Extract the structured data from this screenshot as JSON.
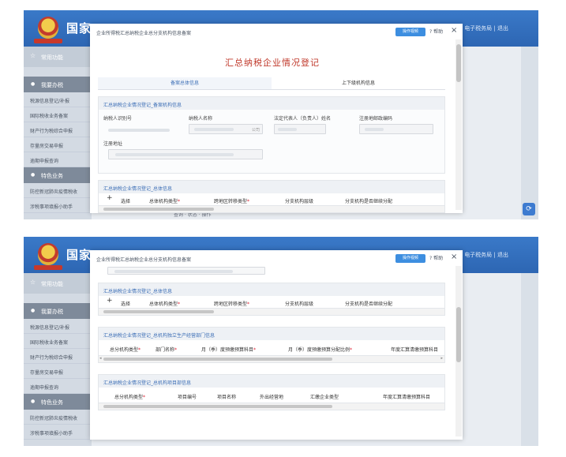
{
  "app": {
    "brand_partial": "国家",
    "header_right": "电子税务局 | 退出"
  },
  "sidebar": {
    "favorites": "常用功能",
    "section_tax": "我要办税",
    "items": [
      "税源信息登记/补报",
      "国际税收业务备案",
      "财产行为税综合申报",
      "存量房交易申报",
      "逾期申报查询"
    ],
    "section_special": "特色业务",
    "special_items": [
      "防控新冠肺炎疫情税收",
      "涉税事项填报小助手"
    ]
  },
  "modal": {
    "window_title": "企业所得税汇总纳税企业总分支机构信息备案",
    "video_button": "操作视频",
    "help_button": "帮助",
    "close_button": "×",
    "form_title": "汇总纳税企业情况登记",
    "tabs": [
      "备案总体信息",
      "上下级机构信息"
    ],
    "record_panel_title": "汇总纳税企业情况登记_备案机构信息",
    "fields": {
      "taxpayer_id_label": "纳税人识别号",
      "taxpayer_name_label": "纳税人名称",
      "legal_rep_label": "法定代表人（负责人）姓名",
      "postcode_label": "注册地邮政编码",
      "address_label": "注册地址",
      "name_suffix": "公司"
    },
    "summary_panel_title": "汇总纳税企业情况登记_总体信息",
    "summary_columns": [
      "选择",
      "总体机构类型",
      "跨地区转移类型",
      "分支机构层级",
      "分支机构是否继续分配"
    ],
    "add_symbol": "+",
    "production_panel_title": "汇总纳税企业情况登记_总机构独立生产经营部门信息",
    "production_columns": [
      "总分机构类型",
      "部门名称",
      "月（季）度预缴预算科目",
      "月（季）度预缴预算分配比例",
      "年度汇算清缴预算科目"
    ],
    "project_panel_title": "汇总纳税企业情况登记_总机构项目部信息",
    "project_columns": [
      "总分机构类型",
      "项目编号",
      "项目名称",
      "外出经营地",
      "汇缴企业类型",
      "年度汇算清缴预算科目"
    ]
  },
  "behind": {
    "row_text": "查询 · 状态 · 操作"
  },
  "colors": {
    "header": "#3a79c8",
    "title_red": "#c0392b",
    "link_blue": "#3d6fb6"
  }
}
